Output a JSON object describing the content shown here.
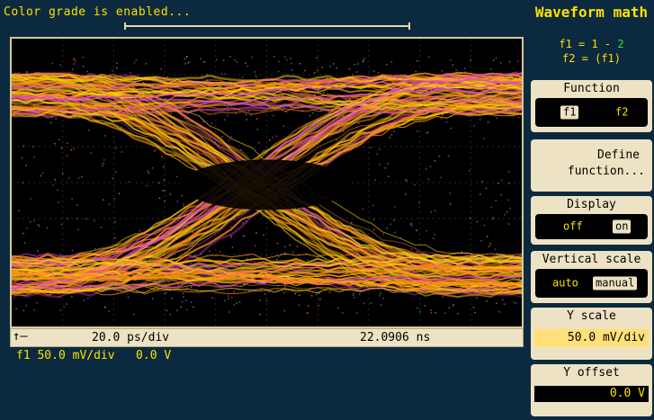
{
  "status_message": "Color grade is enabled...",
  "menu": {
    "title": "Waveform math",
    "f1_def": "f1 = 1 - ",
    "f1_def_b": "2",
    "f2_def": "f2 = (f1)",
    "function": {
      "label": "Function",
      "options": [
        "f1",
        "f2"
      ],
      "selected": "f1"
    },
    "define": {
      "line1": "Define",
      "line2": "function..."
    },
    "display": {
      "label": "Display",
      "options": [
        "off",
        "on"
      ],
      "selected": "on"
    },
    "vscale": {
      "label": "Vertical scale",
      "options": [
        "auto",
        "manual"
      ],
      "selected": "manual"
    },
    "yscale": {
      "label": "Y scale",
      "value": "50.0 mV/div"
    },
    "yoffset": {
      "label": "Y offset",
      "value": "0.0 V"
    }
  },
  "infobar": {
    "timebase": "20.0 ps/div",
    "delay": "22.0906 ns"
  },
  "channel_info": "f1 50.0 mV/div   0.0 V",
  "colors": {
    "background": "#0c2a3f",
    "text_yellow": "#ffe000",
    "panel_bg": "#ede3c4",
    "trace_yellow": "#ffd400",
    "trace_orange": "#ff8a1a",
    "trace_magenta": "#e040d0",
    "trace_green": "#40c060"
  }
}
